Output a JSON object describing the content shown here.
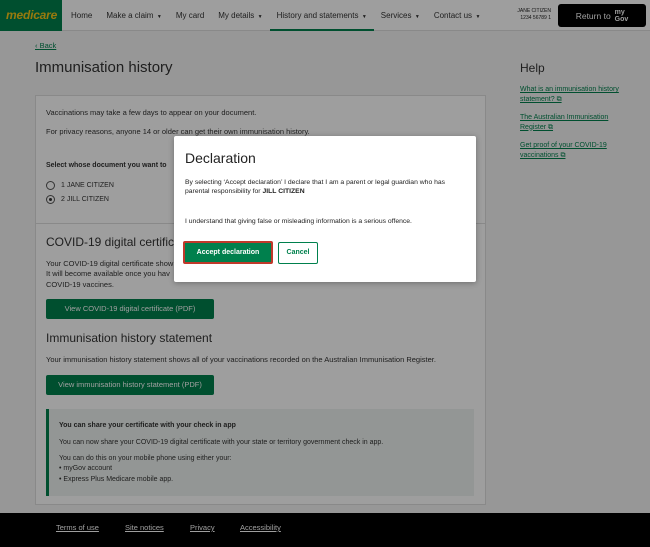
{
  "header": {
    "logo": "medicare",
    "nav": [
      {
        "label": "Home",
        "dropdown": false
      },
      {
        "label": "Make a claim",
        "dropdown": true
      },
      {
        "label": "My card",
        "dropdown": false
      },
      {
        "label": "My details",
        "dropdown": true
      },
      {
        "label": "History and statements",
        "dropdown": true,
        "active": true
      },
      {
        "label": "Services",
        "dropdown": true
      },
      {
        "label": "Contact us",
        "dropdown": true
      }
    ],
    "user_name": "JANE CITIZEN",
    "user_number": "1234 56789 1",
    "return_label": "Return to",
    "mygov_line1": "my",
    "mygov_line2": "Gov"
  },
  "page": {
    "back": "Back",
    "title": "Immunisation history",
    "intro_1": "Vaccinations may take a few days to appear on your document.",
    "intro_2": "For privacy reasons, anyone 14 or older can get their own immunisation history.",
    "select_label": "Select whose document you want to",
    "options": [
      {
        "label": "1 JANE CITIZEN",
        "checked": false
      },
      {
        "label": "2 JILL CITIZEN",
        "checked": true
      }
    ],
    "covid_title": "COVID-19 digital certificate",
    "covid_text_1": "Your COVID-19 digital certificate show",
    "covid_text_2": "It will become available once you hav",
    "covid_text_3": "COVID-19 vaccines.",
    "covid_button": "View COVID-19 digital certificate (PDF)",
    "statement_title": "Immunisation history statement",
    "statement_text": "Your immunisation history statement shows all of your vaccinations recorded on the Australian Immunisation Register.",
    "statement_button": "View immunisation history statement (PDF)",
    "notice": {
      "title": "You can share your certificate with your check in app",
      "text_1": "You can now share your COVID-19 digital certificate with your state or territory government check in app.",
      "text_2": "You can do this on your mobile phone using either your:",
      "bullet_1": "myGov account",
      "bullet_2": "Express Plus Medicare mobile app."
    }
  },
  "help": {
    "title": "Help",
    "links": [
      "What is an immunisation history statement? ⧉",
      "The Australian Immunisation Register ⧉",
      "Get proof of your COVID-19 vaccinations ⧉"
    ]
  },
  "footer": {
    "links": [
      "Terms of use",
      "Site notices",
      "Privacy",
      "Accessibility"
    ]
  },
  "modal": {
    "title": "Declaration",
    "text_1_prefix": "By selecting ‘Accept declaration’ I declare that I am a parent or legal guardian who has parental responsibility for ",
    "text_1_name": "JILL CITIZEN",
    "text_2": "I understand that giving false or misleading information is a serious offence.",
    "accept": "Accept declaration",
    "cancel": "Cancel"
  },
  "colors": {
    "brand_green": "#00804d",
    "logo_yellow": "#f5c518",
    "focus_red": "#c0392b"
  }
}
